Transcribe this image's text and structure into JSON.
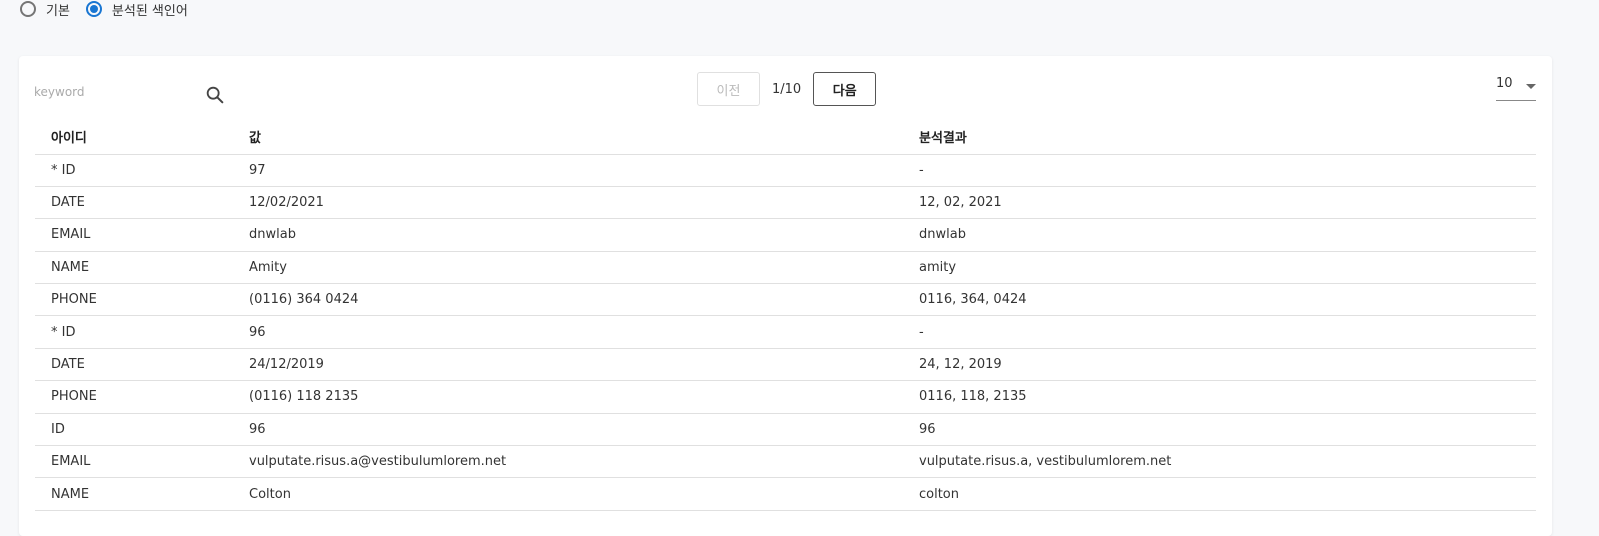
{
  "radio": {
    "options": [
      {
        "label": "기본",
        "checked": false
      },
      {
        "label": "분석된 색인어",
        "checked": true
      }
    ]
  },
  "search": {
    "placeholder": "keyword",
    "value": "",
    "icon": "search-icon"
  },
  "pagination": {
    "prev_label": "이전",
    "page_indicator": "1/10",
    "next_label": "다음"
  },
  "per_page": {
    "value": "10"
  },
  "table": {
    "headers": [
      "아이디",
      "값",
      "분석결과"
    ],
    "rows": [
      [
        "* ID",
        "97",
        "-"
      ],
      [
        "DATE",
        "12/02/2021",
        "12, 02, 2021"
      ],
      [
        "EMAIL",
        "dnwlab",
        "dnwlab"
      ],
      [
        "NAME",
        "Amity",
        "amity"
      ],
      [
        "PHONE",
        "(0116) 364 0424",
        "0116, 364, 0424"
      ],
      [
        "* ID",
        "96",
        "-"
      ],
      [
        "DATE",
        "24/12/2019",
        "24, 12, 2019"
      ],
      [
        "PHONE",
        "(0116) 118 2135",
        "0116, 118, 2135"
      ],
      [
        "ID",
        "96",
        "96"
      ],
      [
        "EMAIL",
        "vulputate.risus.a@vestibulumlorem.net",
        "vulputate.risus.a, vestibulumlorem.net"
      ],
      [
        "NAME",
        "Colton",
        "colton"
      ]
    ]
  },
  "colors": {
    "accent": "#1976d2",
    "border": "#e0e0e0",
    "background": "#f7f8fa"
  }
}
